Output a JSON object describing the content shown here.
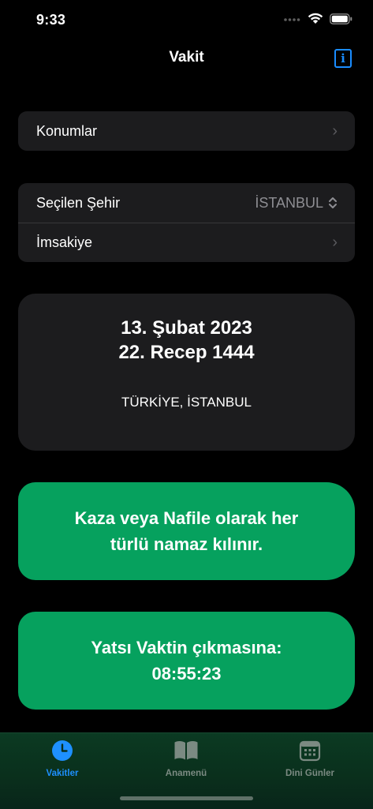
{
  "status": {
    "time": "9:33"
  },
  "nav": {
    "title": "Vakit"
  },
  "settings": {
    "locations_label": "Konumlar",
    "selected_city_label": "Seçilen Şehir",
    "selected_city_value": "İSTANBUL",
    "imsakiye_label": "İmsakiye"
  },
  "date_card": {
    "gregorian": "13. Şubat 2023",
    "hijri": "22. Recep 1444",
    "location": "TÜRKİYE, İSTANBUL"
  },
  "info_card": {
    "line1": "Kaza veya Nafile olarak her",
    "line2": "türlü namaz kılınır."
  },
  "countdown": {
    "line1": "Yatsı Vaktin çıkmasına:",
    "time": "08:55:23"
  },
  "tabs": [
    {
      "label": "Vakitler",
      "icon": "clock-icon",
      "active": true
    },
    {
      "label": "Anamenü",
      "icon": "book-icon",
      "active": false
    },
    {
      "label": "Dini Günler",
      "icon": "calendar-icon",
      "active": false
    }
  ],
  "colors": {
    "accent": "#1e90ff",
    "green": "#06a15e",
    "card": "#1c1c1e"
  }
}
